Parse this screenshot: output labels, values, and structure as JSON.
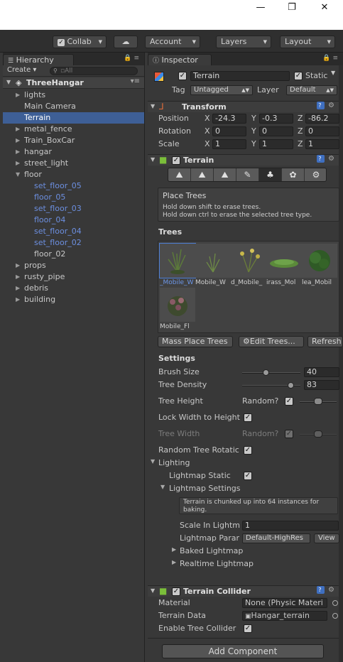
{
  "window": {
    "minimize": "—",
    "restore": "❐",
    "close": "✕"
  },
  "toolbar": {
    "collab": "Collab",
    "collab_checked": "✓",
    "cloud_icon": "cloud-icon",
    "account": "Account",
    "layers": "Layers",
    "layout": "Layout"
  },
  "hierarchy": {
    "tab": "Hierarchy",
    "create": "Create ▾",
    "search_placeholder": "▫All",
    "scene": "ThreeHangar",
    "items": [
      {
        "label": "lights",
        "expandable": true,
        "depth": 0
      },
      {
        "label": "Main Camera",
        "expandable": false,
        "depth": 0
      },
      {
        "label": "Terrain",
        "expandable": false,
        "depth": 0,
        "selected": true
      },
      {
        "label": "metal_fence",
        "expandable": true,
        "depth": 0
      },
      {
        "label": "Train_BoxCar",
        "expandable": true,
        "depth": 0
      },
      {
        "label": "hangar",
        "expandable": true,
        "depth": 0
      },
      {
        "label": "street_light",
        "expandable": true,
        "depth": 0
      },
      {
        "label": "floor",
        "expandable": true,
        "expanded": true,
        "depth": 0
      },
      {
        "label": "set_floor_05",
        "depth": 1,
        "prefab": true
      },
      {
        "label": "floor_05",
        "depth": 1,
        "prefab": true
      },
      {
        "label": "set_floor_03",
        "depth": 1,
        "prefab": true
      },
      {
        "label": "floor_04",
        "depth": 1,
        "prefab": true
      },
      {
        "label": "set_floor_04",
        "depth": 1,
        "prefab": true
      },
      {
        "label": "set_floor_02",
        "depth": 1,
        "prefab": true
      },
      {
        "label": "floor_02",
        "depth": 1,
        "prefab": false
      },
      {
        "label": "props",
        "expandable": true,
        "depth": 0
      },
      {
        "label": "rusty_pipe",
        "expandable": true,
        "depth": 0
      },
      {
        "label": "debris",
        "expandable": true,
        "depth": 0
      },
      {
        "label": "building",
        "expandable": true,
        "depth": 0
      }
    ]
  },
  "inspector": {
    "tab": "Inspector",
    "object": {
      "active": "✓",
      "name": "Terrain",
      "static_checked": "✓",
      "static_label": "Static",
      "tag_label": "Tag",
      "tag_value": "Untagged",
      "layer_label": "Layer",
      "layer_value": "Default"
    },
    "transform": {
      "title": "Transform",
      "rows": [
        {
          "label": "Position",
          "x": "-24.3",
          "y": "-0.3",
          "z": "-86.2"
        },
        {
          "label": "Rotation",
          "x": "0",
          "y": "0",
          "z": "0"
        },
        {
          "label": "Scale",
          "x": "1",
          "y": "1",
          "z": "1"
        }
      ],
      "axis_x": "X",
      "axis_y": "Y",
      "axis_z": "Z"
    },
    "terrain": {
      "title": "Terrain",
      "enabled": "✓",
      "tools": [
        "raise-lower-icon",
        "paint-height-icon",
        "smooth-height-icon",
        "paint-texture-icon",
        "place-trees-icon",
        "paint-details-icon",
        "terrain-settings-icon"
      ],
      "tool_glyphs": [
        "⛰",
        "⛰",
        "⛰",
        "✎",
        "♣",
        "✿",
        "⚙"
      ],
      "help_title": "Place Trees",
      "help_line1": "Hold down shift to erase trees.",
      "help_line2": "Hold down ctrl to erase the selected tree type.",
      "trees_label": "Trees",
      "trees": [
        "_Mobile_W",
        "Mobile_W",
        "d_Mobile_",
        "irass_Mol",
        "lea_Mobil",
        "Mobile_Fl"
      ],
      "mass_place": "Mass Place Trees",
      "edit_trees": "⚙Edit Trees...",
      "refresh": "Refresh",
      "settings_label": "Settings",
      "brush_size_label": "Brush Size",
      "brush_size": "40",
      "brush_size_fraction": 0.4,
      "tree_density_label": "Tree Density",
      "tree_density": "83",
      "tree_density_fraction": 0.83,
      "tree_height_label": "Tree Height",
      "random_label": "Random?",
      "tree_height_random": "✓",
      "lock_width_label": "Lock Width to Height",
      "lock_width": "✓",
      "tree_width_label": "Tree Width",
      "tree_width_random": "✓",
      "random_rotation_label": "Random Tree Rotatic",
      "random_rotation": "✓",
      "lighting_label": "Lighting",
      "lightmap_static_label": "Lightmap Static",
      "lightmap_static": "✓",
      "lightmap_settings_label": "Lightmap Settings",
      "lightmap_note_1": "Terrain is chunked up into 64 instances for",
      "lightmap_note_2": "baking.",
      "scale_in_lightmap_label": "Scale In Lightm",
      "scale_in_lightmap": "1",
      "lightmap_param_label": "Lightmap Parar",
      "lightmap_param": "Default-HighRes",
      "view_label": "View",
      "baked_lightmap": "Baked Lightmap",
      "realtime_lightmap": "Realtime Lightmap"
    },
    "collider": {
      "title": "Terrain Collider",
      "enabled": "✓",
      "material_label": "Material",
      "material_value": "None (Physic Materi",
      "terrain_data_label": "Terrain Data",
      "terrain_data_value": "Hangar_terrain",
      "enable_tree_label": "Enable Tree Collider",
      "enable_tree": "✓"
    },
    "add_component": "Add Component"
  },
  "colors": {
    "selection": "#3e5f96",
    "prefab_text": "#6c8fe0",
    "panel_bg": "#383838"
  }
}
